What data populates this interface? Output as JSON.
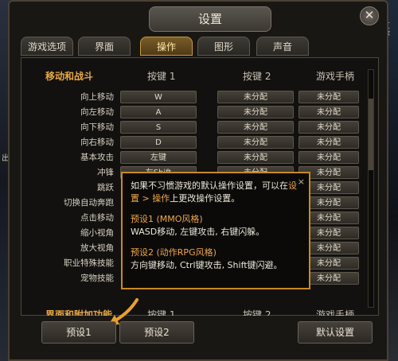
{
  "window": {
    "title": "设置"
  },
  "tabs": [
    "游戏选项",
    "界面",
    "操作",
    "图形",
    "声音"
  ],
  "headers": {
    "section": "移动和战斗",
    "key1": "按键 1",
    "key2": "按键 2",
    "gamepad": "游戏手柄"
  },
  "rows": [
    {
      "label": "向上移动",
      "k1": "W",
      "k2": "未分配",
      "k3": "未分配"
    },
    {
      "label": "向左移动",
      "k1": "A",
      "k2": "未分配",
      "k3": "未分配"
    },
    {
      "label": "向下移动",
      "k1": "S",
      "k2": "未分配",
      "k3": "未分配"
    },
    {
      "label": "向右移动",
      "k1": "D",
      "k2": "未分配",
      "k3": "未分配"
    },
    {
      "label": "基本攻击",
      "k1": "左键",
      "k2": "未分配",
      "k3": "未分配"
    },
    {
      "label": "冲锋",
      "k1": "左Shift",
      "k2": "未分配",
      "k3": "未分配"
    },
    {
      "label": "跳跃",
      "k1": "",
      "k2": "",
      "k3": "未分配"
    },
    {
      "label": "切换自动奔跑",
      "k1": "",
      "k2": "",
      "k3": "未分配"
    },
    {
      "label": "点击移动",
      "k1": "",
      "k2": "",
      "k3": "未分配"
    },
    {
      "label": "缩小视角",
      "k1": "",
      "k2": "",
      "k3": "未分配"
    },
    {
      "label": "放大视角",
      "k1": "",
      "k2": "",
      "k3": "未分配"
    },
    {
      "label": "职业特殊技能",
      "k1": "",
      "k2": "",
      "k3": "未分配"
    },
    {
      "label": "宠物技能",
      "k1": "",
      "k2": "",
      "k3": "未分配"
    }
  ],
  "bottom_headers": {
    "section": "界面和附加功能",
    "key1": "按键 1",
    "key2": "按键 2",
    "gamepad": "游戏手柄"
  },
  "tooltip": {
    "line1a": "如果不习惯游戏的默认操作设置，可以在",
    "line1b": "设置 > 操作",
    "line1c": "上更改操作设置。",
    "p1_title": "预设1 (MMO风格)",
    "p1_body": "WASD移动, 左键攻击, 右键闪躲。",
    "p2_title": "预设2 (动作RPG风格)",
    "p2_body": "方向键移动, Ctrl键攻击, Shift键闪避。",
    "close": "×"
  },
  "buttons": {
    "preset1": "预设1",
    "preset2": "预设2",
    "default": "默认设置"
  },
  "edge_text": {
    "left": "出",
    "right": "艾尔"
  },
  "colors": {
    "accent": "#c98a1e",
    "section_title": "#e8a846"
  }
}
